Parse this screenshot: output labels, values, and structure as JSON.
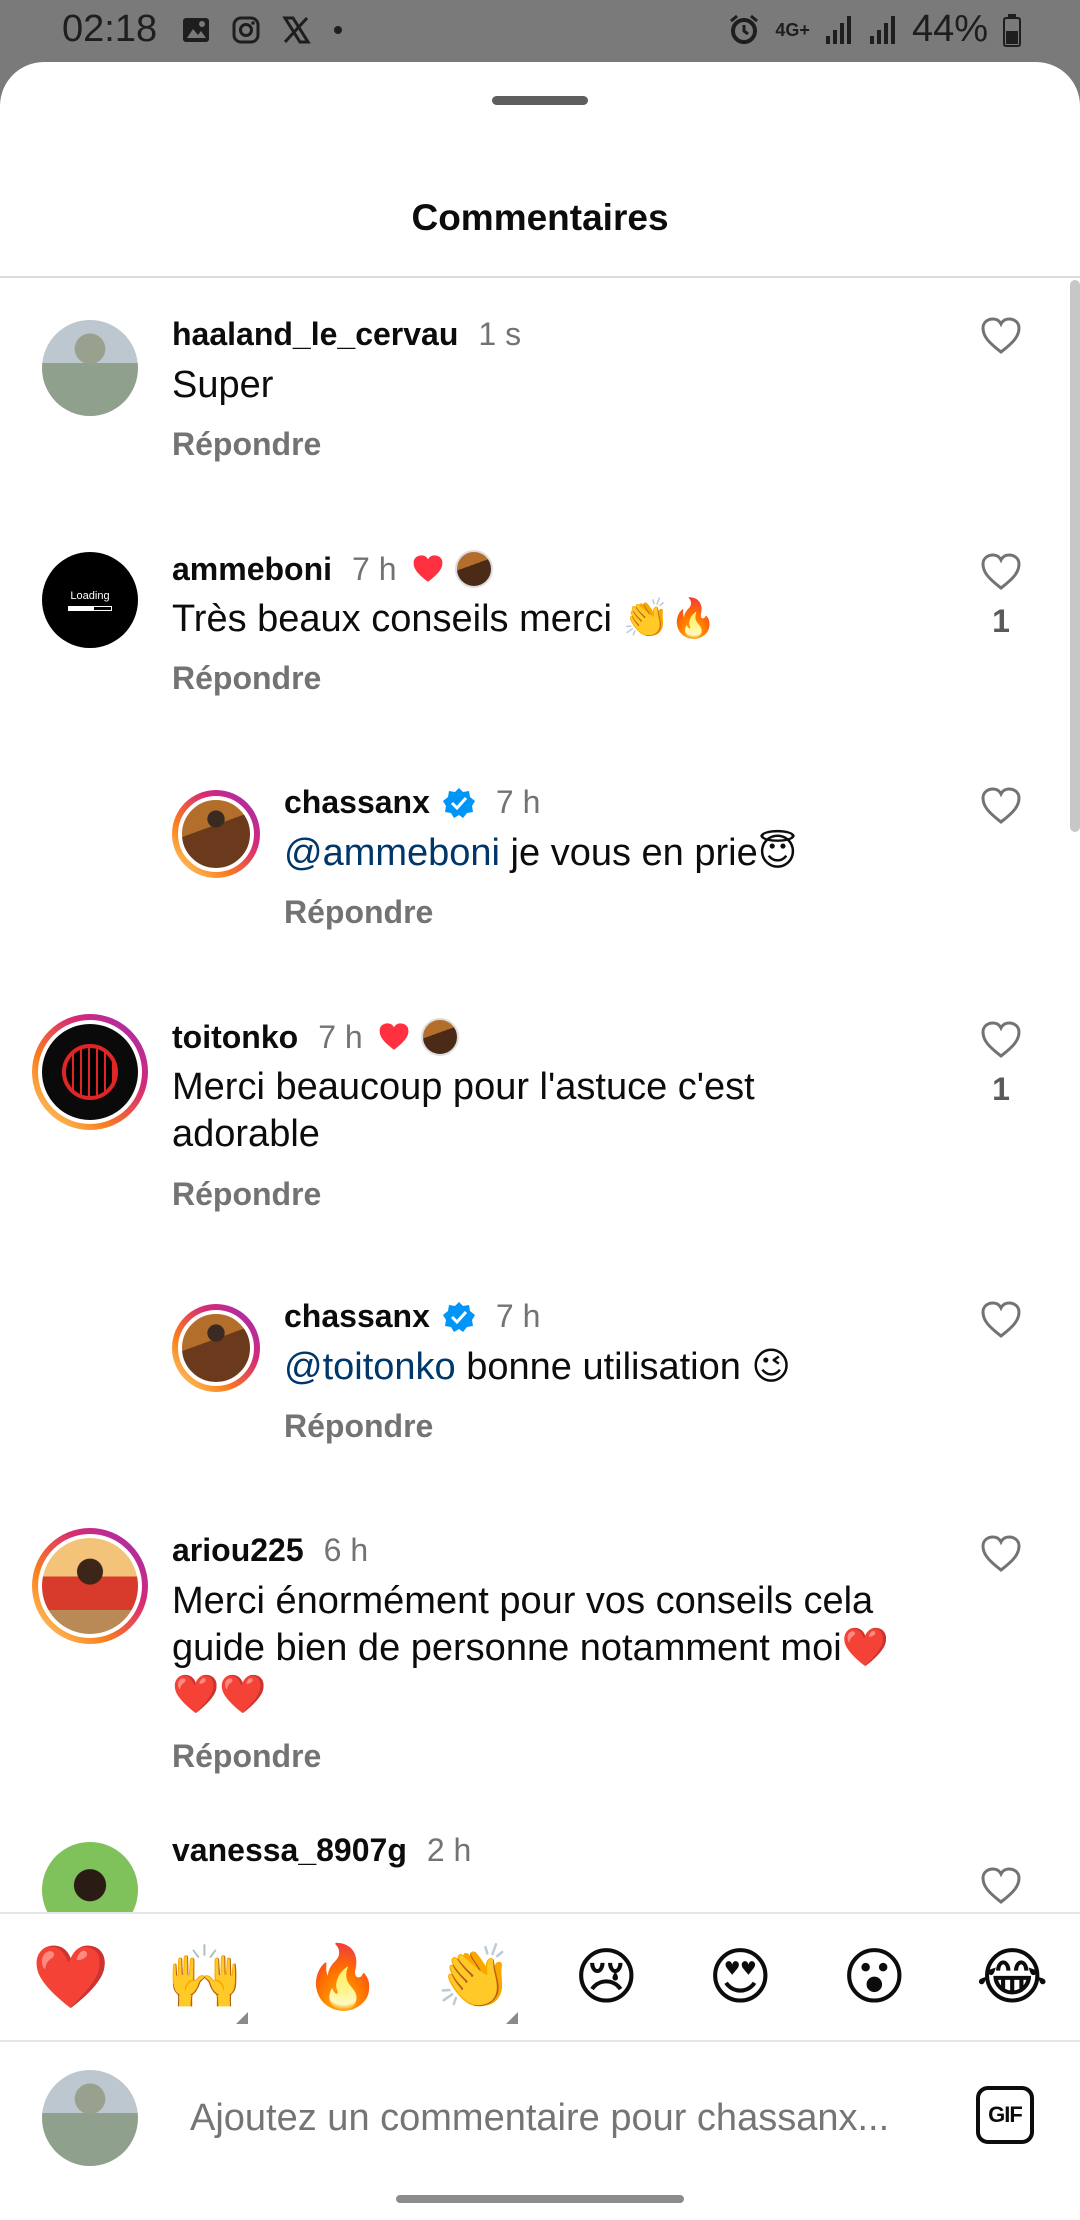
{
  "status_bar": {
    "time": "02:18",
    "left_icons": [
      "gallery-icon",
      "instagram-icon",
      "x-icon",
      "dot-icon"
    ],
    "right_icons": [
      "alarm-icon",
      "4g-icon",
      "signal-icon",
      "signal-icon",
      "battery-icon"
    ],
    "network": "4G+",
    "battery": "44%"
  },
  "sheet": {
    "title": "Commentaires"
  },
  "comments": [
    {
      "username": "haaland_le_cervau",
      "time": "1 s",
      "text": "Super",
      "reply_label": "Répondre",
      "like_count": "",
      "creator_liked": false,
      "verified": false,
      "is_reply": false
    },
    {
      "username": "ammeboni",
      "time": "7 h",
      "text": "Très beaux conseils merci 👏🔥",
      "reply_label": "Répondre",
      "like_count": "1",
      "creator_liked": true,
      "verified": false,
      "is_reply": false
    },
    {
      "username": "chassanx",
      "time": "7 h",
      "mention": "@ammeboni",
      "text": " je vous en prie😇",
      "reply_label": "Répondre",
      "like_count": "",
      "creator_liked": false,
      "verified": true,
      "is_reply": true
    },
    {
      "username": "toitonko",
      "time": "7 h",
      "text": "Merci beaucoup pour l'astuce c'est adorable",
      "reply_label": "Répondre",
      "like_count": "1",
      "creator_liked": true,
      "verified": false,
      "is_reply": false
    },
    {
      "username": "chassanx",
      "time": "7 h",
      "mention": "@toitonko",
      "text": " bonne utilisation 😉",
      "reply_label": "Répondre",
      "like_count": "",
      "creator_liked": false,
      "verified": true,
      "is_reply": true
    },
    {
      "username": "ariou225",
      "time": "6 h",
      "text": "Merci énormément pour vos conseils cela guide bien de personne notamment moi❤️❤️❤️",
      "reply_label": "Répondre",
      "like_count": "",
      "creator_liked": false,
      "verified": false,
      "is_reply": false
    },
    {
      "username": "vanessa_8907g",
      "time": "2 h",
      "text": "",
      "reply_label": "",
      "like_count": "",
      "creator_liked": false,
      "verified": false,
      "is_reply": false
    }
  ],
  "quick_reactions": [
    "❤️",
    "🙌",
    "🔥",
    "👏",
    "😢",
    "😍",
    "😮",
    "😂"
  ],
  "composer": {
    "placeholder": "Ajoutez un commentaire pour chassanx...",
    "gif_label": "GIF"
  },
  "colors": {
    "mention": "#00376b",
    "like_red": "#ff3040",
    "verified_blue": "#0095f6",
    "meta_gray": "#737373"
  }
}
